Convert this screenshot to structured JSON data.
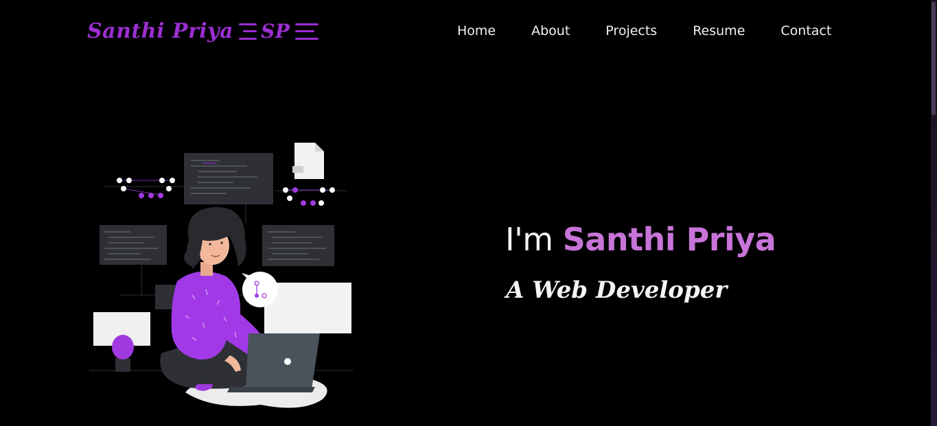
{
  "brand": {
    "name": "Santhi Priya",
    "monogram": "SP"
  },
  "nav": {
    "items": [
      "Home",
      "About",
      "Projects",
      "Resume",
      "Contact"
    ]
  },
  "hero": {
    "greeting": "I'm",
    "name": "Santhi Priya",
    "subtitle": "A Web Developer"
  },
  "colors": {
    "background": "#000000",
    "accent": "#9b2fd1",
    "name_highlight": "#c774d8",
    "text": "#f4f4f4"
  },
  "illustration": {
    "icon": "developer-at-laptop-illustration"
  }
}
